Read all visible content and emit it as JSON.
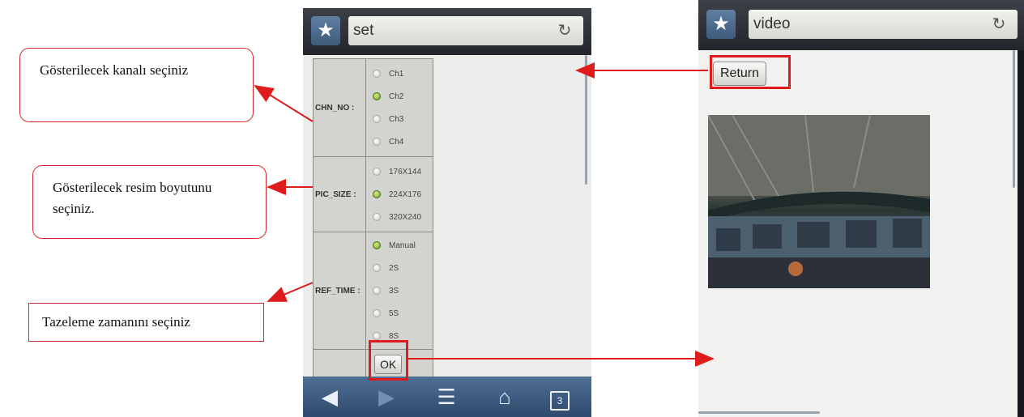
{
  "callouts": {
    "channel": "Gösterilecek kanalı seçiniz",
    "picture_size": "Gösterilecek resim boyutunu seçiniz.",
    "refresh_time": "Tazeleme zamanını seçiniz"
  },
  "left_screen": {
    "url": "set",
    "settings": [
      {
        "label": "CHN_NO :",
        "options": [
          "Ch1",
          "Ch2",
          "Ch3",
          "Ch4"
        ],
        "selected": "Ch2"
      },
      {
        "label": "PIC_SIZE :",
        "options": [
          "176X144",
          "224X176",
          "320X240"
        ],
        "selected": "224X176"
      },
      {
        "label": "REF_TIME :",
        "options": [
          "Manual",
          "2S",
          "3S",
          "5S",
          "8S"
        ],
        "selected": "Manual"
      }
    ],
    "ok_label": "OK",
    "tab_count": "3"
  },
  "right_screen": {
    "url": "video",
    "return_label": "Return"
  },
  "colors": {
    "annotation_red": "#e01b1b",
    "selected_radio": "#6f9a1e",
    "nav_blue": "#3e5a7a"
  },
  "icons": [
    "star-icon",
    "reload-icon",
    "back-icon",
    "forward-icon",
    "menu-icon",
    "home-icon",
    "tabs-icon"
  ]
}
